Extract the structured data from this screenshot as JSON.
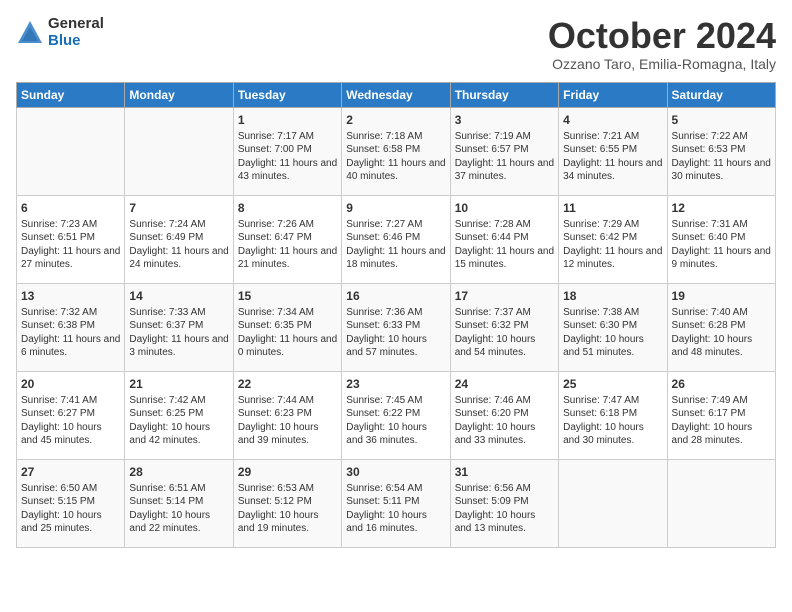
{
  "header": {
    "logo_general": "General",
    "logo_blue": "Blue",
    "month_title": "October 2024",
    "location": "Ozzano Taro, Emilia-Romagna, Italy"
  },
  "days_of_week": [
    "Sunday",
    "Monday",
    "Tuesday",
    "Wednesday",
    "Thursday",
    "Friday",
    "Saturday"
  ],
  "weeks": [
    [
      {
        "day": "",
        "detail": ""
      },
      {
        "day": "",
        "detail": ""
      },
      {
        "day": "1",
        "detail": "Sunrise: 7:17 AM\nSunset: 7:00 PM\nDaylight: 11 hours and 43 minutes."
      },
      {
        "day": "2",
        "detail": "Sunrise: 7:18 AM\nSunset: 6:58 PM\nDaylight: 11 hours and 40 minutes."
      },
      {
        "day": "3",
        "detail": "Sunrise: 7:19 AM\nSunset: 6:57 PM\nDaylight: 11 hours and 37 minutes."
      },
      {
        "day": "4",
        "detail": "Sunrise: 7:21 AM\nSunset: 6:55 PM\nDaylight: 11 hours and 34 minutes."
      },
      {
        "day": "5",
        "detail": "Sunrise: 7:22 AM\nSunset: 6:53 PM\nDaylight: 11 hours and 30 minutes."
      }
    ],
    [
      {
        "day": "6",
        "detail": "Sunrise: 7:23 AM\nSunset: 6:51 PM\nDaylight: 11 hours and 27 minutes."
      },
      {
        "day": "7",
        "detail": "Sunrise: 7:24 AM\nSunset: 6:49 PM\nDaylight: 11 hours and 24 minutes."
      },
      {
        "day": "8",
        "detail": "Sunrise: 7:26 AM\nSunset: 6:47 PM\nDaylight: 11 hours and 21 minutes."
      },
      {
        "day": "9",
        "detail": "Sunrise: 7:27 AM\nSunset: 6:46 PM\nDaylight: 11 hours and 18 minutes."
      },
      {
        "day": "10",
        "detail": "Sunrise: 7:28 AM\nSunset: 6:44 PM\nDaylight: 11 hours and 15 minutes."
      },
      {
        "day": "11",
        "detail": "Sunrise: 7:29 AM\nSunset: 6:42 PM\nDaylight: 11 hours and 12 minutes."
      },
      {
        "day": "12",
        "detail": "Sunrise: 7:31 AM\nSunset: 6:40 PM\nDaylight: 11 hours and 9 minutes."
      }
    ],
    [
      {
        "day": "13",
        "detail": "Sunrise: 7:32 AM\nSunset: 6:38 PM\nDaylight: 11 hours and 6 minutes."
      },
      {
        "day": "14",
        "detail": "Sunrise: 7:33 AM\nSunset: 6:37 PM\nDaylight: 11 hours and 3 minutes."
      },
      {
        "day": "15",
        "detail": "Sunrise: 7:34 AM\nSunset: 6:35 PM\nDaylight: 11 hours and 0 minutes."
      },
      {
        "day": "16",
        "detail": "Sunrise: 7:36 AM\nSunset: 6:33 PM\nDaylight: 10 hours and 57 minutes."
      },
      {
        "day": "17",
        "detail": "Sunrise: 7:37 AM\nSunset: 6:32 PM\nDaylight: 10 hours and 54 minutes."
      },
      {
        "day": "18",
        "detail": "Sunrise: 7:38 AM\nSunset: 6:30 PM\nDaylight: 10 hours and 51 minutes."
      },
      {
        "day": "19",
        "detail": "Sunrise: 7:40 AM\nSunset: 6:28 PM\nDaylight: 10 hours and 48 minutes."
      }
    ],
    [
      {
        "day": "20",
        "detail": "Sunrise: 7:41 AM\nSunset: 6:27 PM\nDaylight: 10 hours and 45 minutes."
      },
      {
        "day": "21",
        "detail": "Sunrise: 7:42 AM\nSunset: 6:25 PM\nDaylight: 10 hours and 42 minutes."
      },
      {
        "day": "22",
        "detail": "Sunrise: 7:44 AM\nSunset: 6:23 PM\nDaylight: 10 hours and 39 minutes."
      },
      {
        "day": "23",
        "detail": "Sunrise: 7:45 AM\nSunset: 6:22 PM\nDaylight: 10 hours and 36 minutes."
      },
      {
        "day": "24",
        "detail": "Sunrise: 7:46 AM\nSunset: 6:20 PM\nDaylight: 10 hours and 33 minutes."
      },
      {
        "day": "25",
        "detail": "Sunrise: 7:47 AM\nSunset: 6:18 PM\nDaylight: 10 hours and 30 minutes."
      },
      {
        "day": "26",
        "detail": "Sunrise: 7:49 AM\nSunset: 6:17 PM\nDaylight: 10 hours and 28 minutes."
      }
    ],
    [
      {
        "day": "27",
        "detail": "Sunrise: 6:50 AM\nSunset: 5:15 PM\nDaylight: 10 hours and 25 minutes."
      },
      {
        "day": "28",
        "detail": "Sunrise: 6:51 AM\nSunset: 5:14 PM\nDaylight: 10 hours and 22 minutes."
      },
      {
        "day": "29",
        "detail": "Sunrise: 6:53 AM\nSunset: 5:12 PM\nDaylight: 10 hours and 19 minutes."
      },
      {
        "day": "30",
        "detail": "Sunrise: 6:54 AM\nSunset: 5:11 PM\nDaylight: 10 hours and 16 minutes."
      },
      {
        "day": "31",
        "detail": "Sunrise: 6:56 AM\nSunset: 5:09 PM\nDaylight: 10 hours and 13 minutes."
      },
      {
        "day": "",
        "detail": ""
      },
      {
        "day": "",
        "detail": ""
      }
    ]
  ]
}
